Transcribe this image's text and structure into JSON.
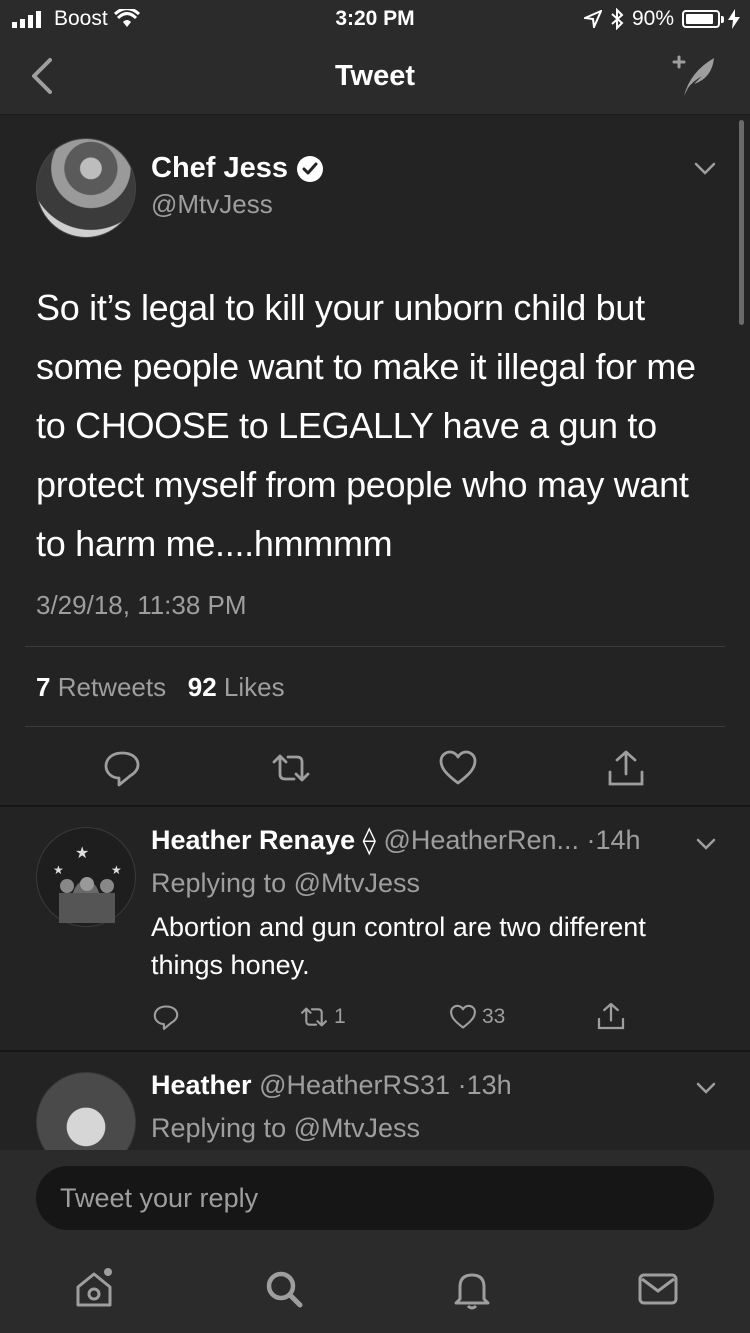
{
  "status_bar": {
    "carrier": "Boost",
    "time": "3:20 PM",
    "battery": "90%",
    "battery_level": 0.9
  },
  "nav": {
    "title": "Tweet"
  },
  "tweet": {
    "author_name": "Chef Jess",
    "author_handle": "@MtvJess",
    "text": "So it’s legal to kill your unborn child but some people want to make it illegal for me to CHOOSE to LEGALLY have a gun to protect myself from people who may want to harm me....hmmmm",
    "timestamp": "3/29/18, 11:38 PM",
    "retweets_count": "7",
    "retweets_label": "Retweets",
    "likes_count": "92",
    "likes_label": "Likes"
  },
  "replies": [
    {
      "name": "Heather Renaye",
      "name_symbol": "⟠",
      "handle": "@HeatherRen...",
      "time": "·14h",
      "replying_to": "Replying to @MtvJess",
      "text": "Abortion and gun control are two different things honey.",
      "retweets": "1",
      "likes": "33"
    },
    {
      "name": "Heather",
      "handle": "@HeatherRS31",
      "time": "·13h",
      "replying_to": "Replying to @MtvJess"
    }
  ],
  "reply_box": {
    "placeholder": "Tweet your reply"
  },
  "colors": {
    "background": "#232323",
    "bar": "#2b2b2b",
    "muted_text": "#9e9e9e"
  },
  "icons": [
    "back-chevron-icon",
    "compose-tweet-icon",
    "verified-badge-icon",
    "chevron-down-icon",
    "reply-icon",
    "retweet-icon",
    "like-icon",
    "share-icon",
    "home-icon",
    "search-icon",
    "notifications-icon",
    "messages-icon"
  ]
}
